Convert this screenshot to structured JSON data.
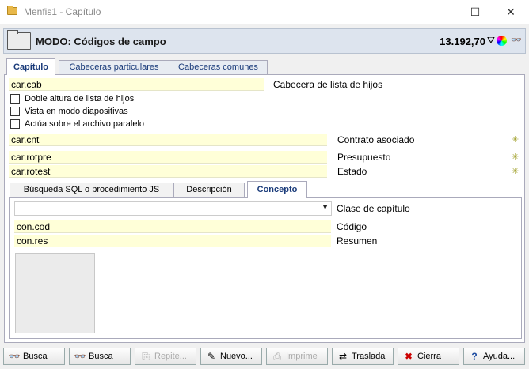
{
  "window": {
    "title": "Menfis1 - Capítulo",
    "minimize": "—",
    "maximize": "☐",
    "close": "✕"
  },
  "header": {
    "mode_title": "MODO: Códigos de campo",
    "amount": "13.192,70",
    "filter_glyph": "⛛",
    "binoculars_glyph": "👓"
  },
  "tabs": [
    {
      "label": "Capítulo",
      "active": true
    },
    {
      "label": "Cabeceras particulares",
      "active": false
    },
    {
      "label": "Cabeceras comunes",
      "active": false
    }
  ],
  "capitulo": {
    "cabecera_value": "car.cab",
    "cabecera_label": "Cabecera de lista de hijos",
    "checkboxes": [
      {
        "label": "Doble altura de lista de hijos",
        "checked": false
      },
      {
        "label": "Vista en modo diapositivas",
        "checked": false
      },
      {
        "label": "Actúa sobre el archivo paralelo",
        "checked": false
      }
    ],
    "contrato_value": "car.cnt",
    "contrato_label": "Contrato asociado",
    "presupuesto_value": "car.rotpre",
    "presupuesto_label": "Presupuesto",
    "estado_value": "car.rotest",
    "estado_label": "Estado",
    "star_glyph": "✳"
  },
  "inner_tabs": [
    {
      "label": "Búsqueda SQL o procedimiento JS",
      "active": false
    },
    {
      "label": "Descripción",
      "active": false
    },
    {
      "label": "Concepto",
      "active": true
    }
  ],
  "concepto": {
    "clase_value": "",
    "clase_label": "Clase de capítulo",
    "codigo_value": "con.cod",
    "codigo_label": "Código",
    "resumen_value": "con.res",
    "resumen_label": "Resumen",
    "dropdown_arrow": "▼"
  },
  "footer_buttons": [
    {
      "label": "Busca",
      "icon": "binoculars-icon",
      "glyph": "👓",
      "enabled": true
    },
    {
      "label": "Busca",
      "icon": "binoculars-icon",
      "glyph": "👓",
      "enabled": true
    },
    {
      "label": "Repite...",
      "icon": "repeat-icon",
      "glyph": "⎘",
      "enabled": false
    },
    {
      "label": "Nuevo...",
      "icon": "new-icon",
      "glyph": "✎",
      "enabled": true
    },
    {
      "label": "Imprime",
      "icon": "printer-icon",
      "glyph": "⎙",
      "enabled": false
    },
    {
      "label": "Traslada",
      "icon": "transfer-icon",
      "glyph": "⇄",
      "enabled": true
    },
    {
      "label": "Cierra",
      "icon": "close-icon",
      "glyph": "✖",
      "enabled": true
    },
    {
      "label": "Ayuda...",
      "icon": "help-icon",
      "glyph": "?",
      "enabled": true
    }
  ]
}
